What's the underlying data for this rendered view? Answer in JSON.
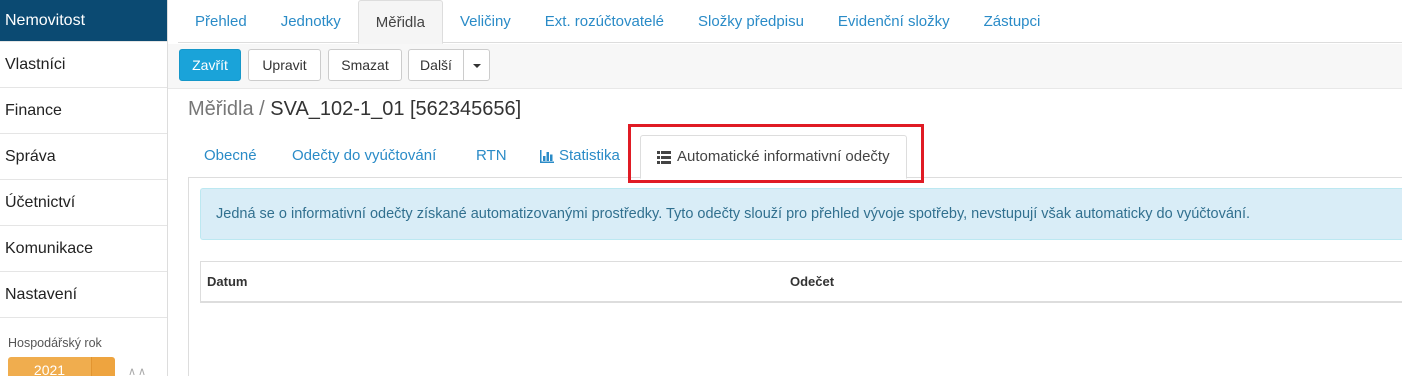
{
  "sidebar": {
    "items": [
      {
        "label": "Nemovitost"
      },
      {
        "label": "Vlastníci"
      },
      {
        "label": "Finance"
      },
      {
        "label": "Správa"
      },
      {
        "label": "Účetnictví"
      },
      {
        "label": "Komunikace"
      },
      {
        "label": "Nastavení"
      }
    ],
    "fiscal_year_label": "Hospodářský rok",
    "fiscal_year_value": "2021"
  },
  "top_tabs": [
    {
      "label": "Přehled"
    },
    {
      "label": "Jednotky"
    },
    {
      "label": "Měřidla"
    },
    {
      "label": "Veličiny"
    },
    {
      "label": "Ext. rozúčtovatelé"
    },
    {
      "label": "Složky předpisu"
    },
    {
      "label": "Evidenční složky"
    },
    {
      "label": "Zástupci"
    }
  ],
  "toolbar": {
    "close_label": "Zavřít",
    "edit_label": "Upravit",
    "delete_label": "Smazat",
    "more_label": "Další"
  },
  "breadcrumb": {
    "parent": "Měřidla /",
    "current": "SVA_102-1_01 [562345656]"
  },
  "sub_tabs": [
    {
      "label": "Obecné"
    },
    {
      "label": "Odečty do vyúčtování"
    },
    {
      "label": "RTN"
    },
    {
      "label": "Statistika",
      "icon": "bar-chart-icon"
    },
    {
      "label": "Automatické informativní odečty",
      "icon": "list-icon"
    }
  ],
  "alert_text": "Jedná se o informativní odečty získané automatizovanými prostředky. Tyto odečty slouží pro přehled vývoje spotřeby, nevstupují však automaticky do vyúčtování.",
  "table": {
    "columns": [
      "Datum",
      "Odečet"
    ]
  },
  "colors": {
    "sidebar_active": "#0b4a72",
    "primary_button": "#1aa3d9",
    "link": "#2a8bc7",
    "alert_bg": "#d9edf7",
    "highlight": "#e01b24",
    "fiscal_year": "#f0ad4e"
  }
}
